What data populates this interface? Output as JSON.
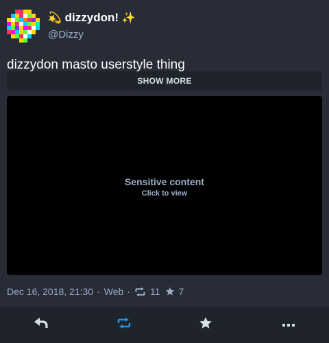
{
  "account": {
    "display_name": "dizzydon!",
    "display_emoji_left": "💫",
    "display_emoji_right": "✨",
    "username": "@Dizzy",
    "avatar": "pixel-avatar"
  },
  "status": {
    "text": "dizzydon masto userstyle thing",
    "show_more_label": "SHOW MORE",
    "media": {
      "title": "Sensitive content",
      "subtitle": "Click to view"
    },
    "meta": {
      "timestamp": "Dec 16, 2018, 21:30",
      "separator": "·",
      "application": "Web",
      "boost_count": "11",
      "favourite_count": "7"
    }
  },
  "action_bar": {
    "reply_icon": "reply-icon",
    "boost_icon": "retweet-icon",
    "favourite_icon": "star-icon",
    "more_icon": "ellipsis-icon",
    "active_color": "#2b90d9",
    "icon_color": "#d9e1e8"
  },
  "colors": {
    "background": "#282c37",
    "bar_background": "#1f232b",
    "secondary_text": "#9baec8",
    "media_background": "#000000"
  }
}
